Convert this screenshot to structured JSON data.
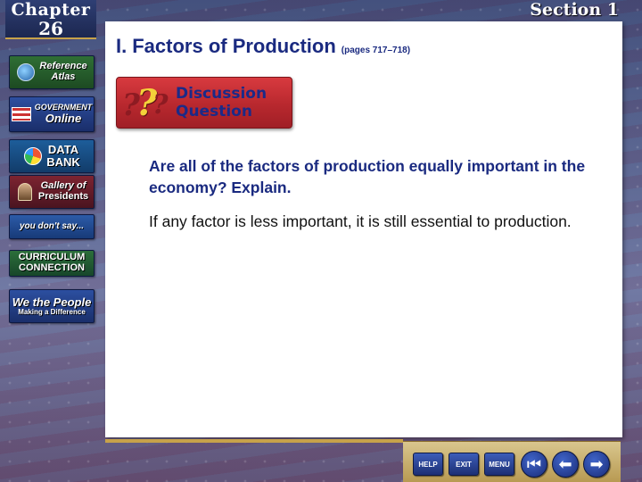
{
  "header": {
    "chapter_word": "Chapter",
    "chapter_number": "26",
    "section": "Section 1"
  },
  "sidebar": {
    "items": [
      {
        "label_line1": "Reference",
        "label_line2": "Atlas",
        "icon": "globe-icon"
      },
      {
        "label_line1": "GOVERNMENT",
        "label_line2": "Online",
        "icon": "flag-icon"
      },
      {
        "label_line1": "DATA",
        "label_line2": "BANK",
        "icon": "pie-icon"
      },
      {
        "label_line1": "Gallery of",
        "label_line2": "Presidents",
        "icon": "portrait-icon"
      },
      {
        "label_line1": "you don't say...",
        "label_line2": "",
        "icon": ""
      },
      {
        "label_line1": "CURRICULUM",
        "label_line2": "CONNECTION",
        "icon": ""
      },
      {
        "label_line1": "We the People",
        "label_line2": "Making a Difference",
        "icon": ""
      }
    ]
  },
  "slide": {
    "roman": "I.",
    "title": "Factors of Production",
    "pages": "(pages 717–718)",
    "badge_line1": "Discussion",
    "badge_line2": "Question",
    "question": "Are all of the factors of production equally important in the economy? Explain.",
    "answer": "If any factor is less important, it is still essential to production."
  },
  "nav": {
    "help": "HELP",
    "exit": "EXIT",
    "menu": "MENU"
  }
}
